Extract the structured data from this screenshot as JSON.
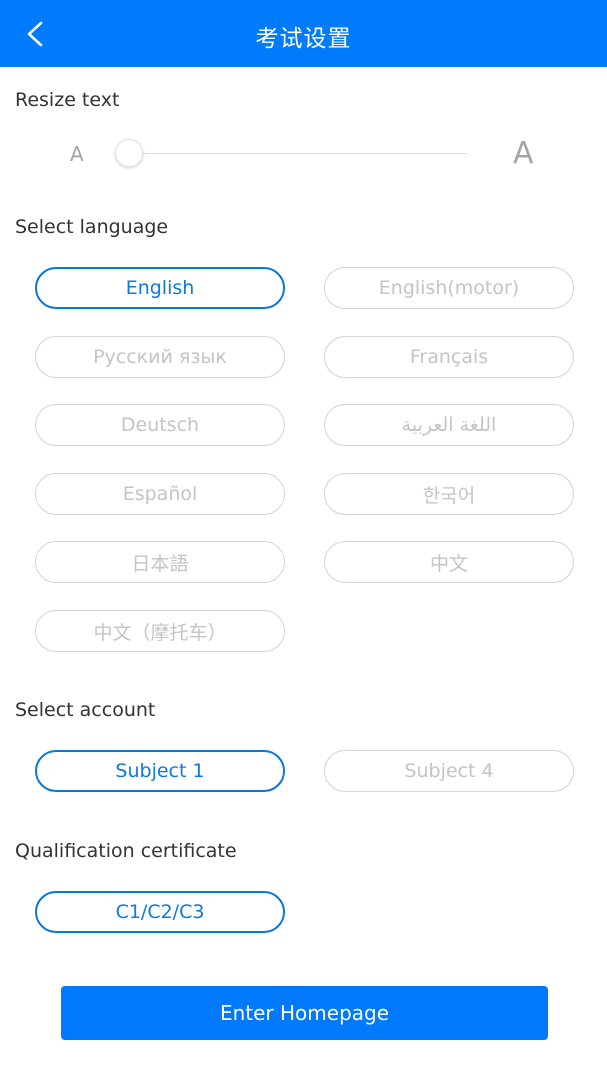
{
  "header": {
    "title": "考试设置",
    "back_icon": "chevron-left-icon",
    "background": "#007bfb"
  },
  "resize_text": {
    "label": "Resize text",
    "small_marker": "A",
    "large_marker": "A",
    "slider_value_fraction": 0
  },
  "language": {
    "label": "Select language",
    "options": [
      {
        "label": "English",
        "selected": true
      },
      {
        "label": "English(motor)",
        "selected": false
      },
      {
        "label": "Русский язык",
        "selected": false
      },
      {
        "label": "Français",
        "selected": false
      },
      {
        "label": "Deutsch",
        "selected": false
      },
      {
        "label": "اللغة العربية",
        "selected": false
      },
      {
        "label": "Español",
        "selected": false
      },
      {
        "label": "한국어",
        "selected": false
      },
      {
        "label": "日本語",
        "selected": false
      },
      {
        "label": "中文",
        "selected": false
      },
      {
        "label": "中文（摩托车）",
        "selected": false
      }
    ]
  },
  "account": {
    "label": "Select account",
    "options": [
      {
        "label": "Subject 1",
        "selected": true
      },
      {
        "label": "Subject 4",
        "selected": false
      }
    ]
  },
  "certificate": {
    "label": "Qualification certificate",
    "options": [
      {
        "label": "C1/C2/C3",
        "selected": true
      }
    ]
  },
  "cta": {
    "label": "Enter Homepage",
    "color": "#0079fb"
  },
  "colors": {
    "accent": "#0a76e0",
    "inactive_border": "#d3d3d3",
    "inactive_text": "#c4c4c4"
  }
}
